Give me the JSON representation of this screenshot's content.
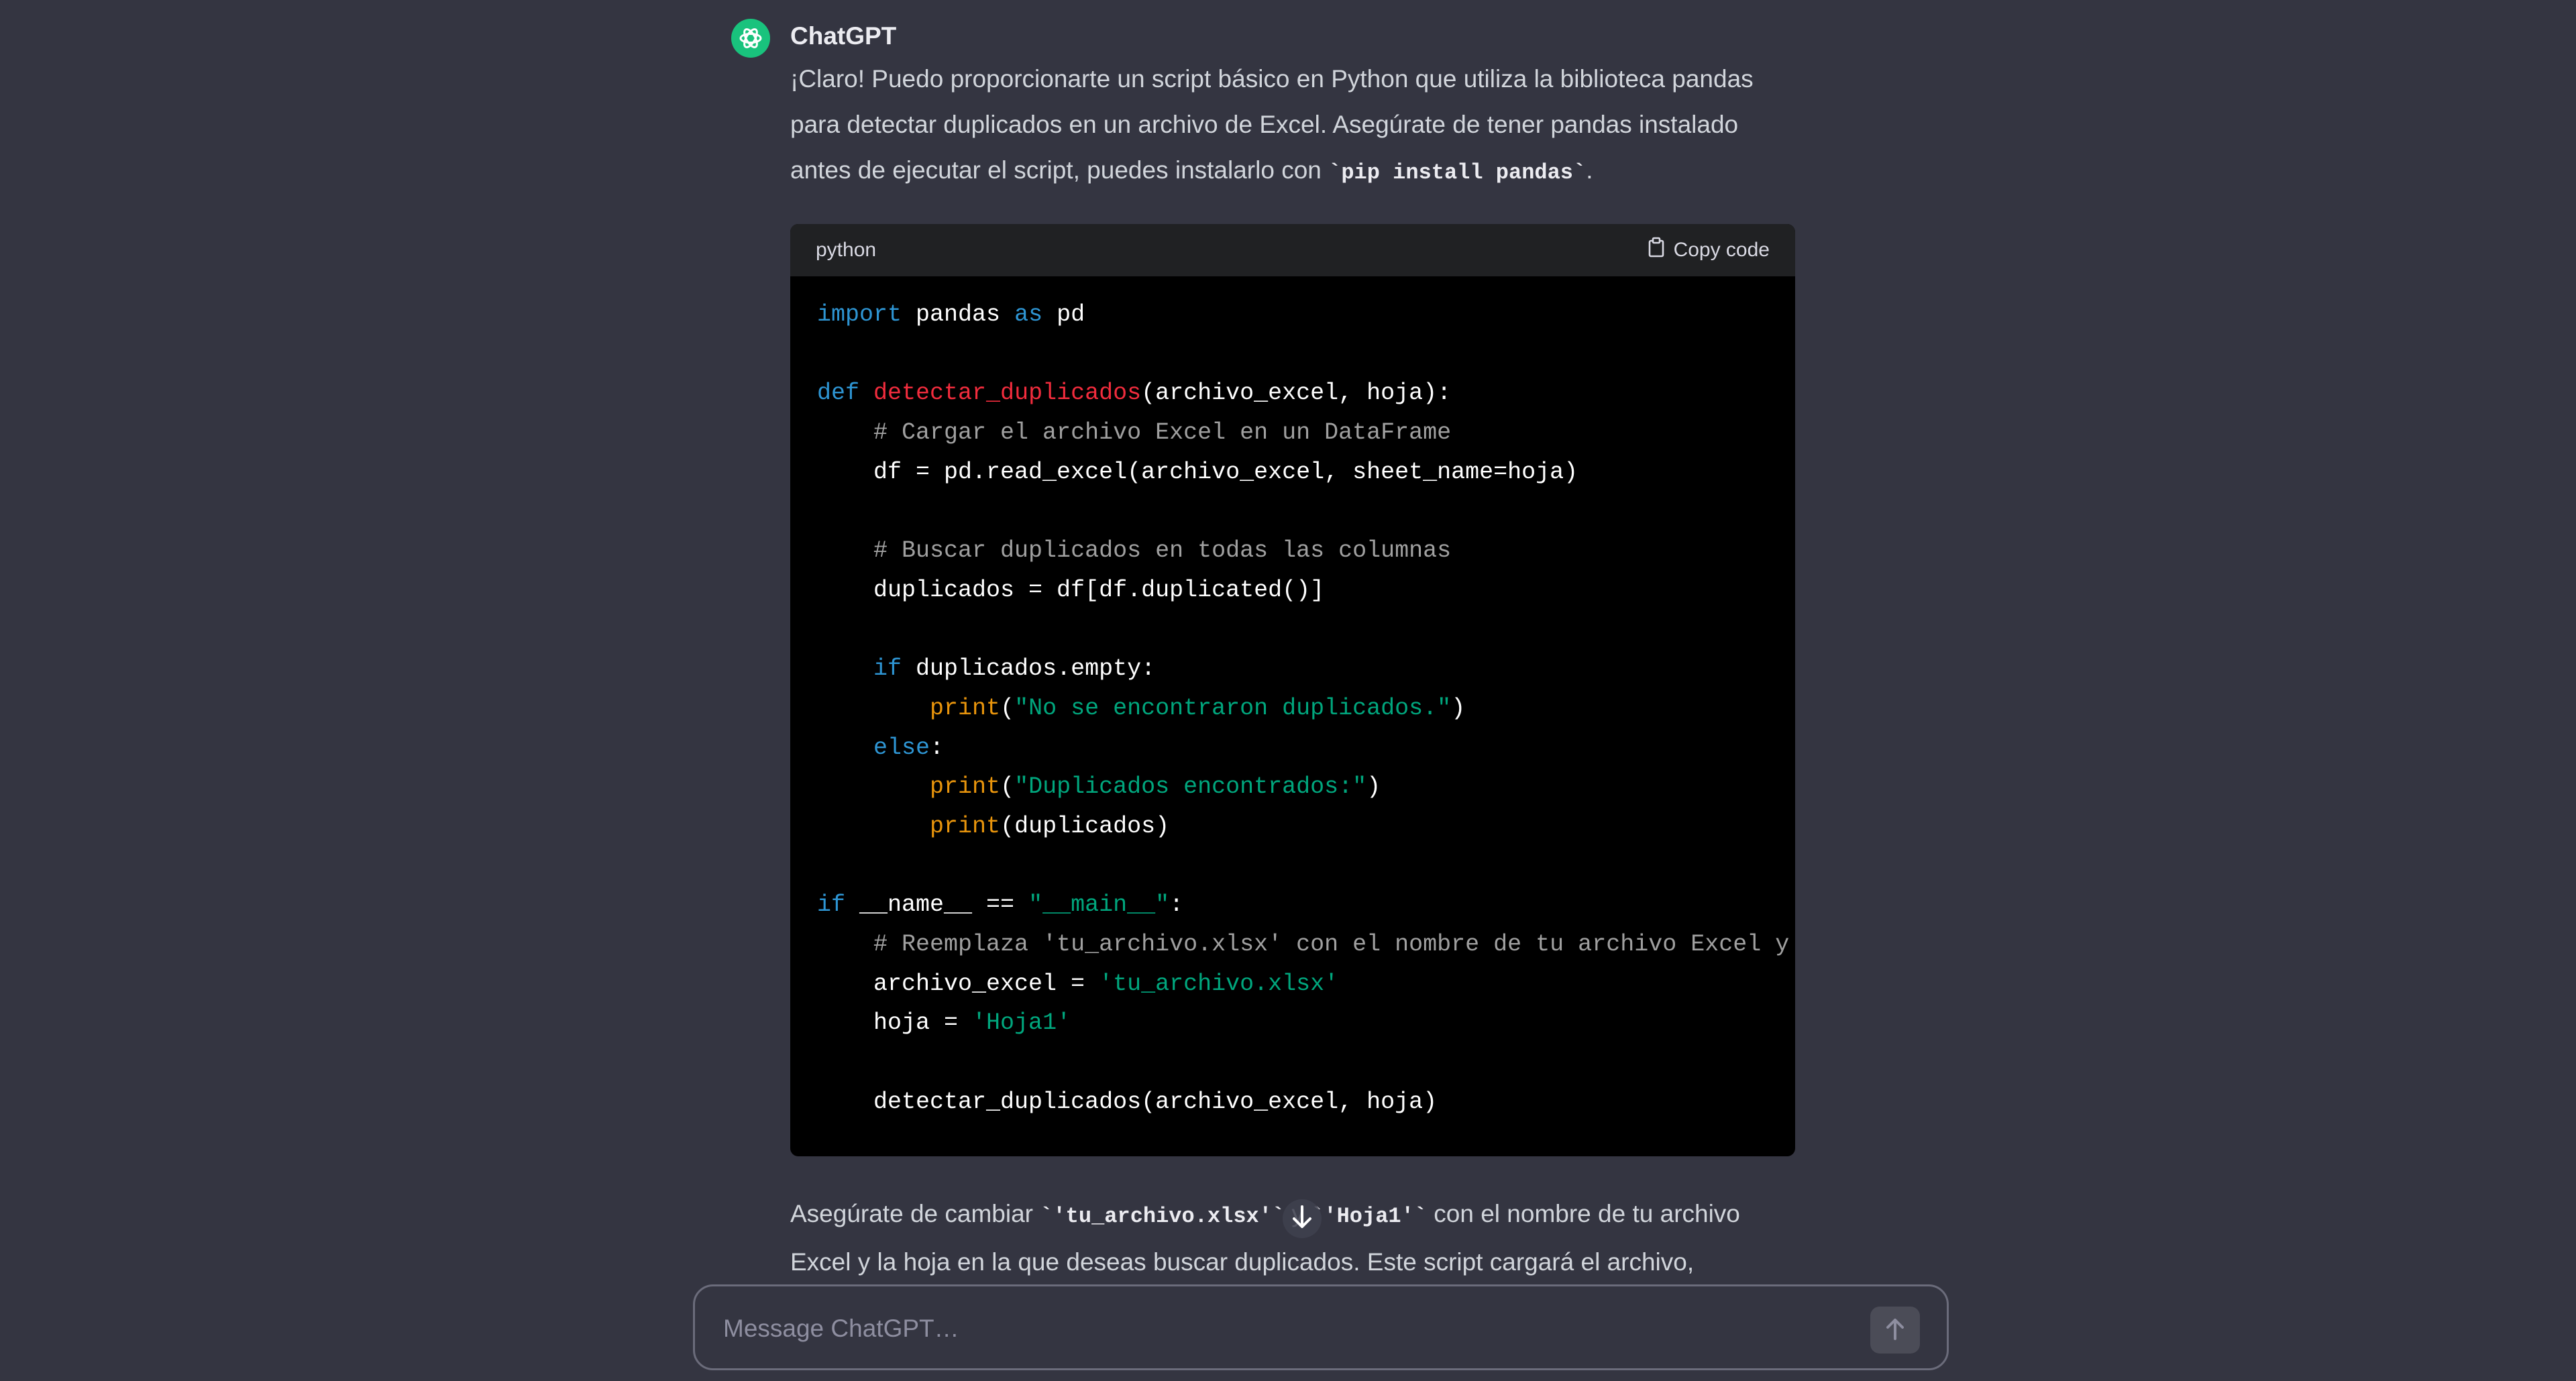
{
  "message": {
    "sender": "ChatGPT",
    "intro_text": "¡Claro! Puedo proporcionarte un script básico en Python que utiliza la biblioteca pandas para detectar duplicados en un archivo de Excel. Asegúrate de tener pandas instalado antes de ejecutar el script, puedes instalarlo con ",
    "intro_code": "`pip install pandas`",
    "intro_end": ".",
    "outro_a": "Asegúrate de cambiar ",
    "outro_code1": "`'tu_archivo.xlsx'`",
    "outro_b": " y ",
    "outro_code2": "`'Hoja1'`",
    "outro_c": " con el nombre de tu archivo Excel y la hoja en la que deseas buscar duplicados. Este script cargará el archivo,"
  },
  "code_block": {
    "language": "python",
    "copy_label": "Copy code",
    "lines": [
      [
        {
          "t": "import",
          "c": "kw"
        },
        {
          "t": " pandas "
        },
        {
          "t": "as",
          "c": "kw"
        },
        {
          "t": " pd"
        }
      ],
      [],
      [
        {
          "t": "def",
          "c": "kw"
        },
        {
          "t": " "
        },
        {
          "t": "detectar_duplicados",
          "c": "fn"
        },
        {
          "t": "(archivo_excel, hoja):"
        }
      ],
      [
        {
          "t": "    "
        },
        {
          "t": "# Cargar el archivo Excel en un DataFrame",
          "c": "cm"
        }
      ],
      [
        {
          "t": "    df = pd.read_excel(archivo_excel, sheet_name=hoja)"
        }
      ],
      [],
      [
        {
          "t": "    "
        },
        {
          "t": "# Buscar duplicados en todas las columnas",
          "c": "cm"
        }
      ],
      [
        {
          "t": "    duplicados = df[df.duplicated()]"
        }
      ],
      [],
      [
        {
          "t": "    "
        },
        {
          "t": "if",
          "c": "kw"
        },
        {
          "t": " duplicados.empty:"
        }
      ],
      [
        {
          "t": "        "
        },
        {
          "t": "print",
          "c": "bi"
        },
        {
          "t": "("
        },
        {
          "t": "\"No se encontraron duplicados.\"",
          "c": "st"
        },
        {
          "t": ")"
        }
      ],
      [
        {
          "t": "    "
        },
        {
          "t": "else",
          "c": "kw"
        },
        {
          "t": ":"
        }
      ],
      [
        {
          "t": "        "
        },
        {
          "t": "print",
          "c": "bi"
        },
        {
          "t": "("
        },
        {
          "t": "\"Duplicados encontrados:\"",
          "c": "st"
        },
        {
          "t": ")"
        }
      ],
      [
        {
          "t": "        "
        },
        {
          "t": "print",
          "c": "bi"
        },
        {
          "t": "(duplicados)"
        }
      ],
      [],
      [
        {
          "t": "if",
          "c": "kw"
        },
        {
          "t": " __name__ == "
        },
        {
          "t": "\"__main__\"",
          "c": "st"
        },
        {
          "t": ":"
        }
      ],
      [
        {
          "t": "    "
        },
        {
          "t": "# Reemplaza 'tu_archivo.xlsx' con el nombre de tu archivo Excel y '",
          "c": "cm"
        }
      ],
      [
        {
          "t": "    archivo_excel = "
        },
        {
          "t": "'tu_archivo.xlsx'",
          "c": "st"
        }
      ],
      [
        {
          "t": "    hoja = "
        },
        {
          "t": "'Hoja1'",
          "c": "st"
        }
      ],
      [],
      [
        {
          "t": "    detectar_duplicados(archivo_excel, hoja)"
        }
      ]
    ]
  },
  "composer": {
    "placeholder": "Message ChatGPT…"
  },
  "icons": {
    "avatar": "chatgpt-logo-icon",
    "copy": "clipboard-icon",
    "scroll": "arrow-down-icon",
    "send": "arrow-up-icon"
  },
  "colors": {
    "background": "#343541",
    "avatar_bg": "#19c37d",
    "code_bg": "#000000",
    "code_header_bg": "#202123",
    "keyword": "#2e95d3",
    "function": "#f22c3d",
    "comment": "#a0a0a0",
    "string": "#00a67d",
    "builtin": "#e9950c"
  }
}
